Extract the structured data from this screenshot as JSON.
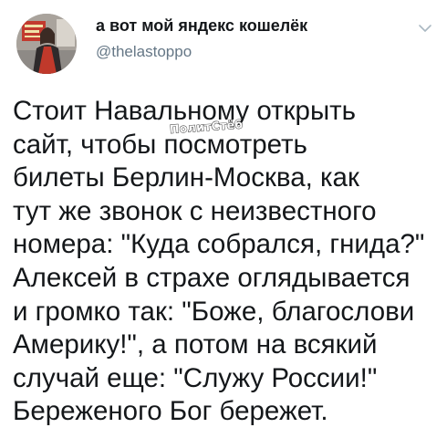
{
  "author": {
    "display_name": "а вот мой яндекс кошелёк",
    "handle": "@thelastoppo",
    "avatar_icon": "user-avatar-photo"
  },
  "menu": {
    "icon": "chevron-down-icon",
    "color": "#aab8c2"
  },
  "tweet": {
    "lines": [
      "Стоит Навальному открыть",
      "сайт, чтобы посмотреть",
      "билеты Берлин-Москва, как",
      "тут же звонок с неизвестного",
      "номера: \"Куда собрался, гнида?\"",
      "Алексей в страхе оглядывается",
      "и громко так: \"Боже, благослови",
      "Америку!\", а потом на всякий",
      "случай еще: \"Служу России!\"",
      "Береженого Бог бережет."
    ]
  },
  "watermark": {
    "text": "ПолитСтёб"
  },
  "colors": {
    "text": "#14171a",
    "secondary_text": "#657786",
    "background": "#ffffff"
  }
}
